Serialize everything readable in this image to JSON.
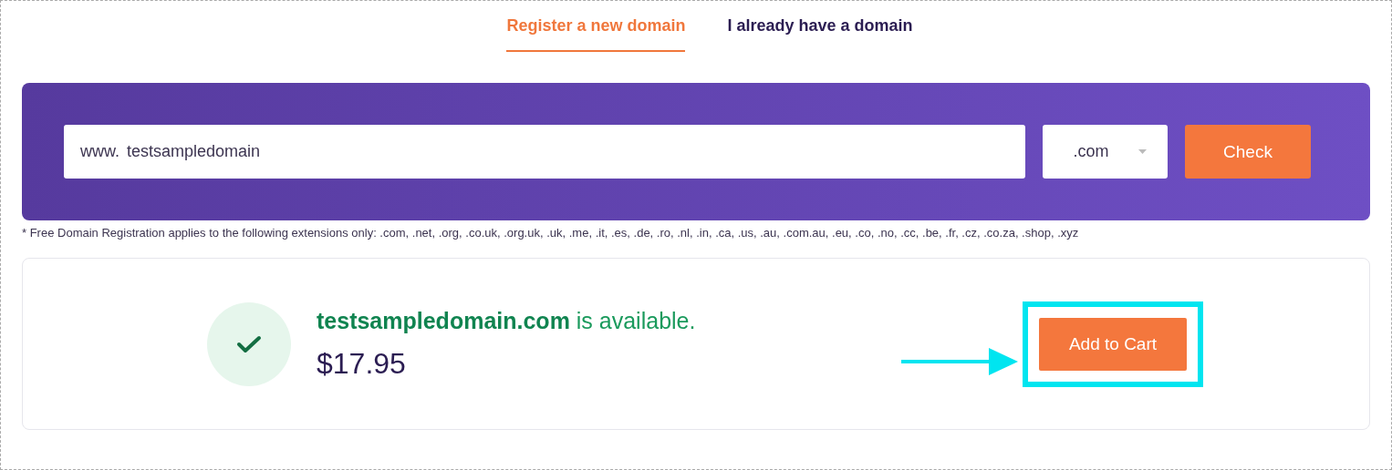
{
  "tabs": [
    {
      "label": "Register a new domain",
      "selected": true
    },
    {
      "label": "I already have a domain",
      "selected": false
    }
  ],
  "search": {
    "prefix": "www.",
    "value": "testsampledomain",
    "extension": ".com",
    "button": "Check"
  },
  "note": "* Free Domain Registration applies to the following extensions only: .com, .net, .org, .co.uk, .org.uk, .uk, .me, .it, .es, .de, .ro, .nl, .in, .ca, .us, .au, .com.au, .eu, .co, .no, .cc, .be, .fr, .cz, .co.za, .shop, .xyz",
  "result": {
    "domain": "testsampledomain.com",
    "status": "is available.",
    "available": true,
    "price": "$17.95",
    "button": "Add to Cart",
    "highlighted": true
  }
}
